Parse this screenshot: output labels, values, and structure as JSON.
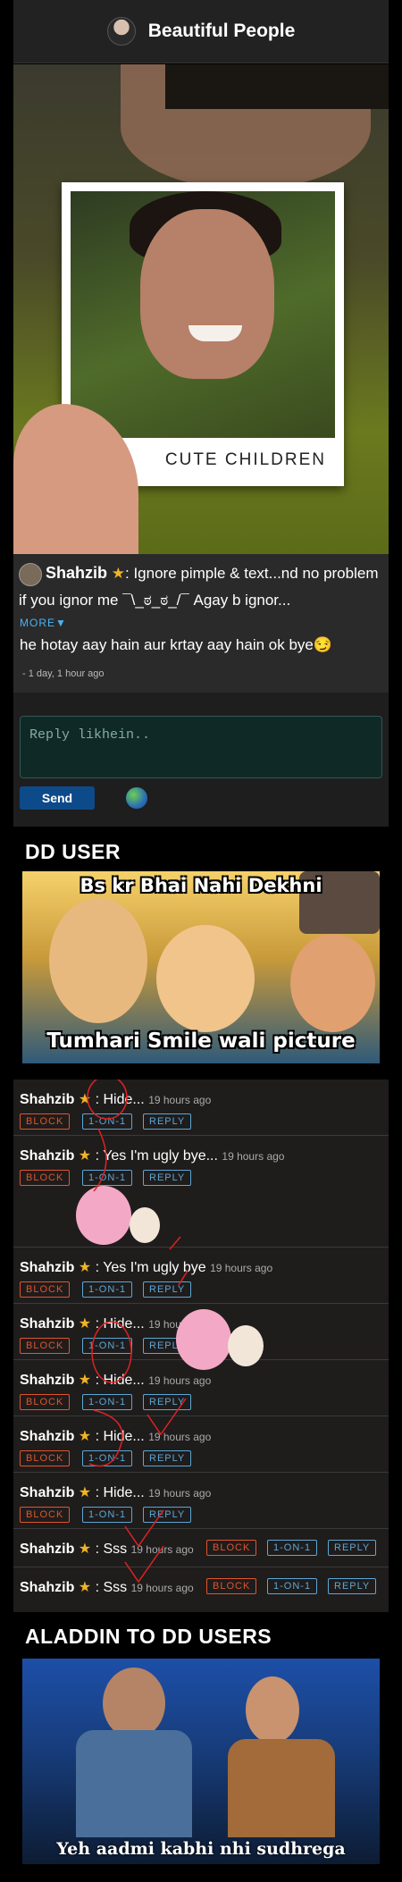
{
  "header": {
    "title": "Beautiful People"
  },
  "photo": {
    "caption": "CUTE CHILDREN"
  },
  "post": {
    "username": "Shahzib",
    "text": ": Ignore pimple & text...nd no problem if you ignor me ¯\\_ಠ_ಠ_/¯ Agay b ignor...",
    "more": "MORE▼",
    "text2": "he hotay aay hain aur krtay aay hain ok bye😏",
    "time": "- 1 day, 1 hour ago"
  },
  "reply": {
    "placeholder": "Reply likhein..",
    "send_label": "Send"
  },
  "section1": {
    "title": "DD USER"
  },
  "meme1": {
    "top": "Bs kr Bhai Nahi Dekhni",
    "bottom": "Tumhari Smile wali picture"
  },
  "buttons": {
    "block": "BLOCK",
    "one_on_one": "1-ON-1",
    "reply": "REPLY"
  },
  "comments": [
    {
      "user": "Shahzib",
      "text": ": Hide...",
      "time": "19 hours ago"
    },
    {
      "user": "Shahzib",
      "text": ": Yes I'm ugly bye...",
      "time": "19 hours ago"
    },
    {
      "user": "Shahzib",
      "text": ": Yes I'm ugly bye",
      "time": "19 hours ago"
    },
    {
      "user": "Shahzib",
      "text": ": Hide...",
      "time": "19 hours ago"
    },
    {
      "user": "Shahzib",
      "text": ": Hide...",
      "time": "19 hours ago"
    },
    {
      "user": "Shahzib",
      "text": ": Hide...",
      "time": "19 hours ago"
    },
    {
      "user": "Shahzib",
      "text": ": Hide...",
      "time": "19 hours ago"
    },
    {
      "user": "Shahzib",
      "text": ": Sss",
      "time": "19 hours ago"
    },
    {
      "user": "Shahzib",
      "text": ": Sss",
      "time": "19 hours ago"
    }
  ],
  "section2": {
    "title": "ALADDIN TO DD USERS"
  },
  "meme2": {
    "caption": "Yeh aadmi kabhi nhi sudhrega"
  },
  "colors": {
    "block": "#e0552b",
    "link": "#5ba7d6",
    "star": "#f0b42a",
    "send": "#0d4a8a"
  }
}
